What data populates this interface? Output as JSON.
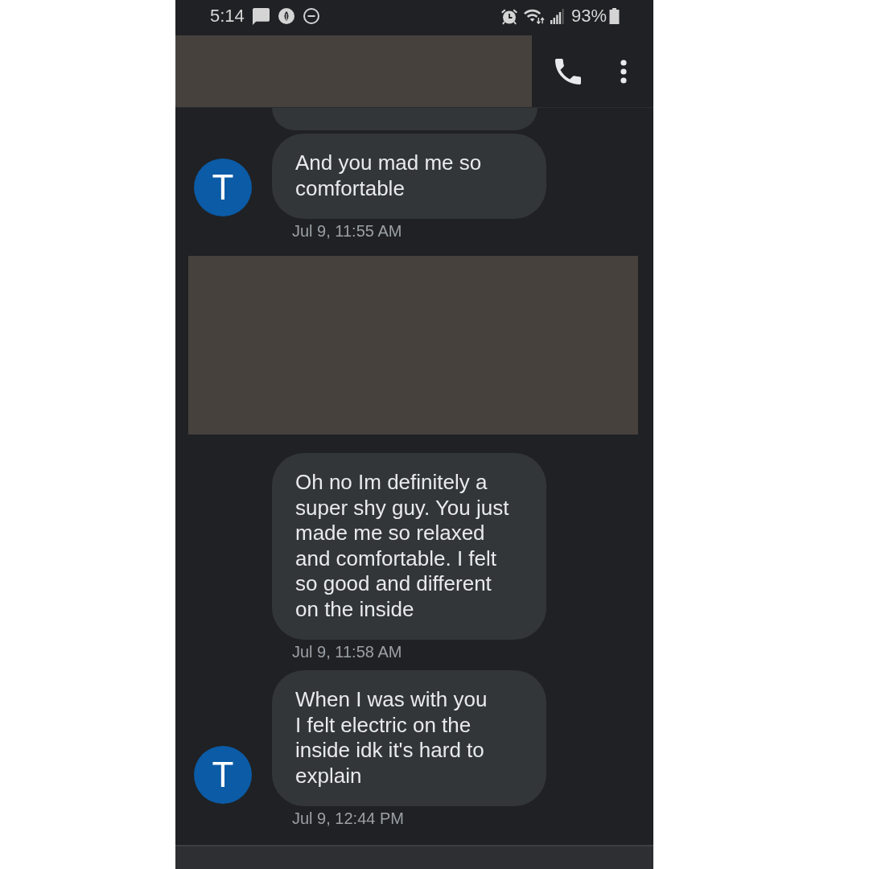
{
  "status_bar": {
    "time": "5:14",
    "battery": "93%"
  },
  "thread": [
    {
      "kind": "clipped"
    },
    {
      "kind": "message",
      "avatar": "T",
      "text": "And you mad me so comfortable",
      "time": "Jul 9, 11:55 AM"
    },
    {
      "kind": "redacted"
    },
    {
      "kind": "message",
      "text": "Oh no Im definitely a super shy guy. You just made me so relaxed and comfortable. I felt so good and different on the inside",
      "time": "Jul 9, 11:58 AM"
    },
    {
      "kind": "message",
      "avatar": "T",
      "text": "When I was with you\nI felt electric on the inside idk it's hard to explain",
      "time": "Jul 9, 12:44 PM"
    }
  ]
}
